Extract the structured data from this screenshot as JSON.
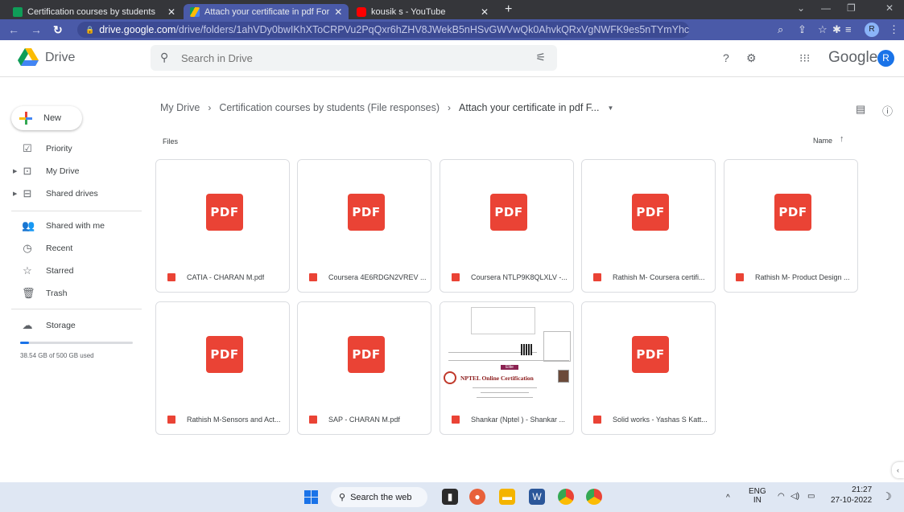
{
  "browser": {
    "tabs": [
      {
        "title": "Certification courses by students",
        "active": false
      },
      {
        "title": "Attach your certificate in pdf For",
        "active": true
      },
      {
        "title": "kousik s - YouTube",
        "active": false
      }
    ],
    "new_tab_label": "+",
    "url_host": "drive.google.com",
    "url_path": "/drive/folders/1ahVDy0bwIKhXToCRPVu2PqQxr6hZHV8JWekB5nHSvGWVwQk0AhvkQRxVgNWFK9es5nTYmYhc",
    "profile_letter": "R"
  },
  "header": {
    "app_name": "Drive",
    "search_placeholder": "Search in Drive",
    "brand_word": "Google",
    "account_letter": "R"
  },
  "sidebar": {
    "new_label": "New",
    "items": [
      {
        "label": "Priority",
        "icon": "priority-icon"
      },
      {
        "label": "My Drive",
        "icon": "my-drive-icon"
      },
      {
        "label": "Shared drives",
        "icon": "shared-drives-icon"
      },
      {
        "label": "Shared with me",
        "icon": "shared-with-me-icon"
      },
      {
        "label": "Recent",
        "icon": "clock-icon"
      },
      {
        "label": "Starred",
        "icon": "star-icon"
      },
      {
        "label": "Trash",
        "icon": "trash-icon"
      },
      {
        "label": "Storage",
        "icon": "cloud-icon"
      }
    ],
    "storage_text": "38.54 GB of 500 GB used",
    "storage_fraction": 0.077
  },
  "breadcrumb": {
    "root": "My Drive",
    "parent": "Certification courses by students (File responses)",
    "current": "Attach your certificate in pdf F..."
  },
  "files_section": {
    "heading": "Files",
    "sort_label": "Name"
  },
  "files": [
    {
      "name": "CATIA - CHARAN M.pdf",
      "thumb": "PDF"
    },
    {
      "name": "Coursera 4E6RDGN2VREV ...",
      "thumb": "PDF"
    },
    {
      "name": "Coursera NTLP9K8QLXLV -...",
      "thumb": "PDF"
    },
    {
      "name": "Rathish M- Coursera certifi...",
      "thumb": "PDF"
    },
    {
      "name": "Rathish M- Product Design ...",
      "thumb": "PDF"
    },
    {
      "name": "Rathish M-Sensors and Act...",
      "thumb": "PDF"
    },
    {
      "name": "SAP - CHARAN M.pdf",
      "thumb": "PDF"
    },
    {
      "name": "Shankar (Nptel ) - Shankar ...",
      "thumb": "certificate"
    },
    {
      "name": "Solid works - Yashas S Katt...",
      "thumb": "PDF"
    }
  ],
  "certificate_preview": {
    "badge": "Elite",
    "title": "NPTEL Online Certification"
  },
  "taskbar": {
    "search_text": "Search the web",
    "lang_top": "ENG",
    "lang_bottom": "IN",
    "time": "21:27",
    "date": "27-10-2022"
  },
  "colors": {
    "chrome_dark": "#35363a",
    "chrome_accent": "#4a5aa8",
    "pdf_red": "#ea4335",
    "google_blue": "#1a73e8"
  }
}
